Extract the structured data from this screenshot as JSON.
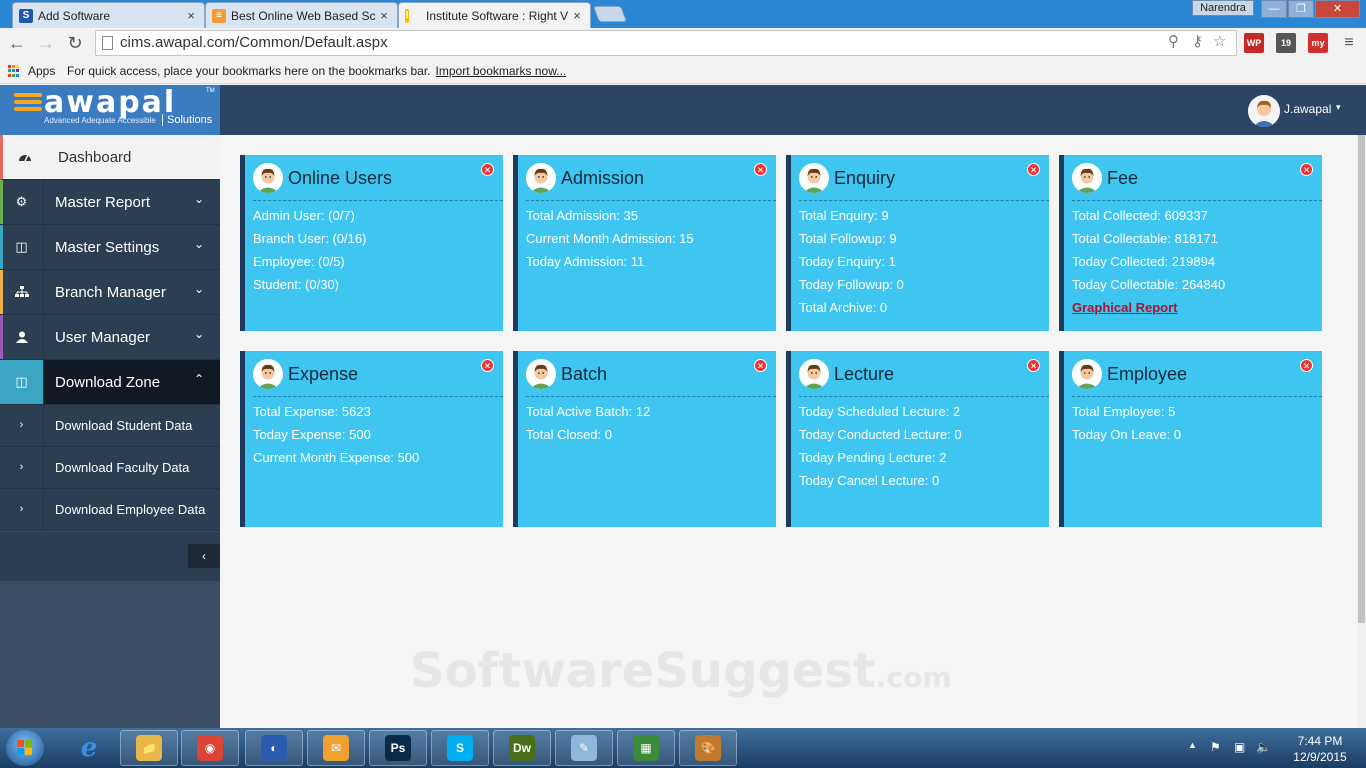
{
  "browser": {
    "tabs": [
      {
        "label": "Add Software",
        "favicon": "S",
        "favicon_color": "#1e5aa8"
      },
      {
        "label": "Best Online Web Based Sc",
        "favicon": "≡",
        "favicon_color": "#f0a030"
      },
      {
        "label": "Institute Software : Right V",
        "favicon": "!",
        "favicon_color": "#f5c000"
      }
    ],
    "tab_close_glyph": "×",
    "user_badge": "Narendra",
    "window_buttons": {
      "minimize": "—",
      "maximize": "❐",
      "close": "✕"
    },
    "url": "cims.awapal.com/Common/Default.aspx",
    "extensions": [
      {
        "label": "WP",
        "badge": "n/a",
        "color": "#c62828"
      },
      {
        "label": "19",
        "color": "#555555"
      },
      {
        "label": "my",
        "color": "#d32f2f"
      }
    ],
    "bookmarks": {
      "apps_label": "Apps",
      "hint": "For quick access, place your bookmarks here on the bookmarks bar.",
      "import_link": "Import bookmarks now..."
    }
  },
  "app": {
    "brand": {
      "name": "awapal",
      "tm": "TM",
      "tagline": "Advanced Adequate Accessible",
      "solutions": "Solutions"
    },
    "user": {
      "name": "J.awapal",
      "caret": "▾"
    },
    "sidebar": {
      "dashboard": {
        "label": "Dashboard",
        "icon": "dashboard-icon"
      },
      "items": [
        {
          "label": "Master Report",
          "icon": "gear-icon",
          "strip": "#6ab04c"
        },
        {
          "label": "Master Settings",
          "icon": "columns-icon",
          "strip": "#3aa6c4"
        },
        {
          "label": "Branch Manager",
          "icon": "sitemap-icon",
          "strip": "#f0ad4e"
        },
        {
          "label": "User Manager",
          "icon": "user-icon",
          "strip": "#9b59b6"
        },
        {
          "label": "Download Zone",
          "icon": "columns-icon",
          "strip": "#3aa6c4"
        }
      ],
      "subitems": [
        {
          "label": "Download Student Data"
        },
        {
          "label": "Download Faculty Data"
        },
        {
          "label": "Download Employee Data"
        }
      ],
      "collapse_glyph": "‹"
    },
    "cards": [
      {
        "title": "Online Users",
        "lines": [
          "Admin User: (0/7)",
          "Branch User: (0/16)",
          "Employee: (0/5)",
          "Student: (0/30)"
        ]
      },
      {
        "title": "Admission",
        "lines": [
          "Total Admission: 35",
          "Current Month Admission: 15",
          "Today Admission: 11"
        ]
      },
      {
        "title": "Enquiry",
        "lines": [
          "Total Enquiry: 9",
          "Total Followup: 9",
          "Today Enquiry: 1",
          "Today Followup: 0",
          "Total Archive: 0"
        ]
      },
      {
        "title": "Fee",
        "lines": [
          "Total Collected: 609337",
          "Total Collectable: 818171",
          "Today Collected: 219894",
          "Today Collectable: 264840"
        ],
        "link": "Graphical Report"
      },
      {
        "title": "Expense",
        "lines": [
          "Total Expense: 5623",
          "Today Expense: 500",
          "Current Month Expense: 500"
        ]
      },
      {
        "title": "Batch",
        "lines": [
          "Total Active Batch: 12",
          "Total Closed: 0"
        ]
      },
      {
        "title": "Lecture",
        "lines": [
          "Today Scheduled Lecture: 2",
          "Today Conducted Lecture: 0",
          "Today Pending Lecture: 2",
          "Today Cancel Lecture: 0"
        ]
      },
      {
        "title": "Employee",
        "lines": [
          "Total Employee: 5",
          "Today On Leave: 0"
        ]
      }
    ],
    "card_close_glyph": "✕",
    "watermark": {
      "main": "SoftwareSuggest",
      "suffix": ".com"
    }
  },
  "taskbar": {
    "apps": [
      {
        "name": "explorer",
        "glyph": "📁",
        "color": "#e8b84a"
      },
      {
        "name": "chrome",
        "glyph": "◉",
        "color": "#db4437"
      },
      {
        "name": "firefox",
        "glyph": "◐",
        "color": "#2a5db0"
      },
      {
        "name": "outlook",
        "glyph": "✉",
        "color": "#f0a030"
      },
      {
        "name": "photoshop",
        "glyph": "Ps",
        "color": "#0a2a4a"
      },
      {
        "name": "skype",
        "glyph": "S",
        "color": "#00aff0"
      },
      {
        "name": "dreamweaver",
        "glyph": "Dw",
        "color": "#4a6e1a"
      },
      {
        "name": "notepad",
        "glyph": "✎",
        "color": "#8fb7d8"
      },
      {
        "name": "calculator",
        "glyph": "▦",
        "color": "#3a8a3a"
      },
      {
        "name": "paint",
        "glyph": "🎨",
        "color": "#c07a30"
      }
    ],
    "time": "7:44 PM",
    "date": "12/9/2015"
  }
}
